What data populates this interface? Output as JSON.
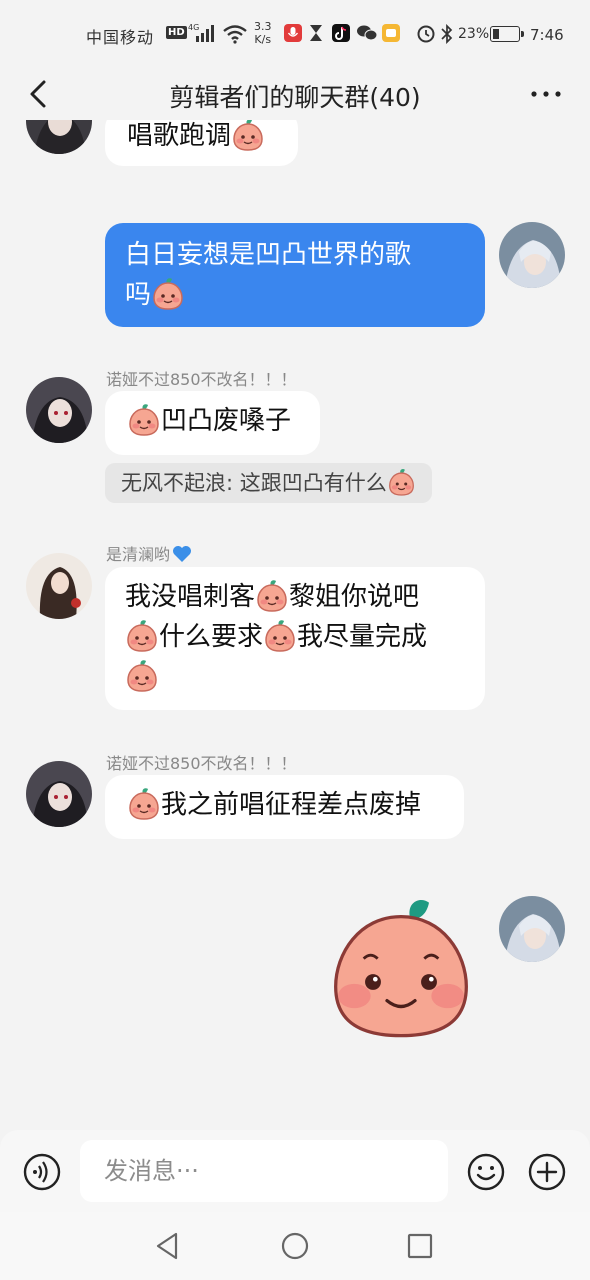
{
  "status": {
    "carrier": "中国移动",
    "hd": "HD",
    "network": "4G",
    "speed_value": "3.3",
    "speed_unit": "K/s",
    "battery": "23%",
    "battery_level": 0.23,
    "time": "7:46"
  },
  "header": {
    "title": "剪辑者们的聊天群(40)"
  },
  "messages": [
    {
      "text": "唱歌跑调"
    },
    {
      "text_line1": "白日妄想是凹凸世界的歌",
      "text_line2": "吗"
    },
    {
      "sender": "诺娅不过850不改名！！！",
      "text": "凹凸废嗓子"
    },
    {
      "quote": "无风不起浪: 这跟凹凸有什么"
    },
    {
      "sender": "是清澜哟",
      "line1_a": "我没唱刺客",
      "line1_b": "黎姐你说吧",
      "line2_a": "什么要求",
      "line2_b": "我尽量完成"
    },
    {
      "sender": "诺娅不过850不改名！！！",
      "text": "我之前唱征程差点废掉"
    }
  ],
  "input": {
    "placeholder": "发消息···"
  },
  "icons": {
    "back": "chevron-left-icon",
    "more": "more-dots-icon",
    "voice": "voice-icon",
    "emoji": "smile-icon",
    "add": "plus-icon",
    "emoji_sticker": "peach-emoji-icon"
  },
  "colors": {
    "outgoing_bubble": "#3a86ee",
    "incoming_bubble": "#ffffff",
    "background": "#f3f3f3",
    "emoji_pink": "#f6a692"
  }
}
